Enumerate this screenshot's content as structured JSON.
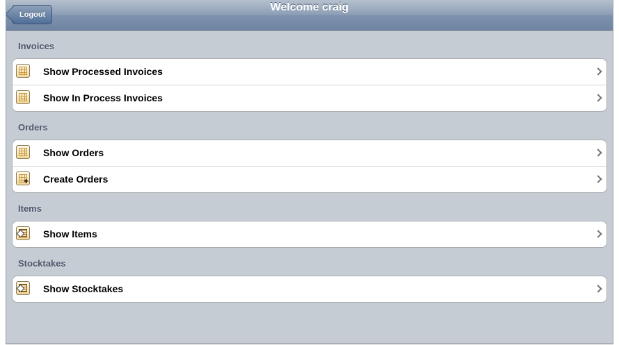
{
  "nav": {
    "back_label": "Logout",
    "title": "Welcome craig"
  },
  "sections": [
    {
      "header": "Invoices",
      "rows": [
        {
          "label": "Show Processed Invoices",
          "icon": "table-icon"
        },
        {
          "label": "Show In Process Invoices",
          "icon": "table-icon"
        }
      ]
    },
    {
      "header": "Orders",
      "rows": [
        {
          "label": "Show Orders",
          "icon": "table-icon"
        },
        {
          "label": "Create Orders",
          "icon": "table-add-icon"
        }
      ]
    },
    {
      "header": "Items",
      "rows": [
        {
          "label": "Show Items",
          "icon": "item-list-icon"
        }
      ]
    },
    {
      "header": "Stocktakes",
      "rows": [
        {
          "label": "Show Stocktakes",
          "icon": "item-list-icon"
        }
      ]
    }
  ],
  "colors": {
    "nav_bar": "#7f93ae",
    "background": "#c5ccd4",
    "section_header": "#4c566c"
  }
}
